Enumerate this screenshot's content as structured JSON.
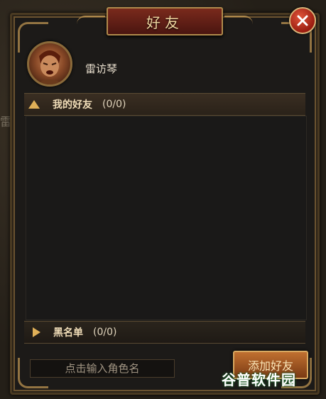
{
  "window": {
    "title": "好友"
  },
  "background": {
    "side_char": "雷"
  },
  "player": {
    "name": "雷访琴"
  },
  "friends_section": {
    "label": "我的好友",
    "count": "(0/0)",
    "expanded": true
  },
  "blacklist_section": {
    "label": "黑名单",
    "count": "(0/0)",
    "expanded": false
  },
  "search": {
    "placeholder": "点击输入角色名"
  },
  "add_button": {
    "label": "添加好友"
  },
  "watermark": {
    "text": "谷普软件园"
  },
  "colors": {
    "accent_gold": "#e0b058",
    "title_red": "#7a2a1c",
    "close_red": "#c0301c"
  }
}
